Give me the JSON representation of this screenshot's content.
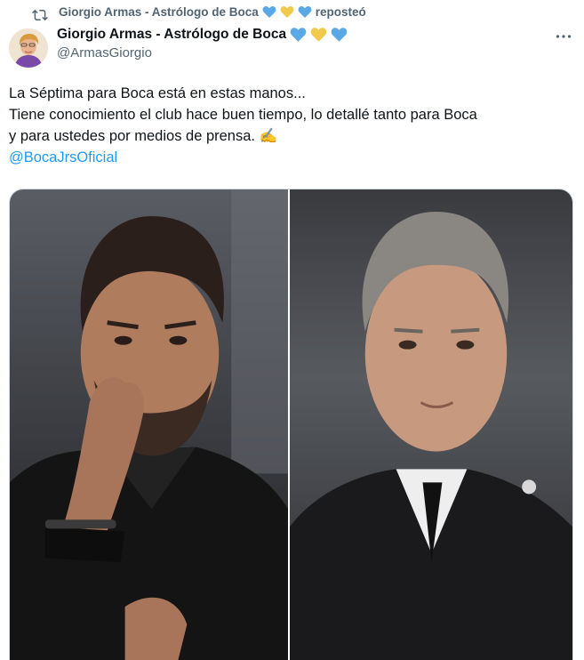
{
  "repost": {
    "text": "Giorgio Armas - Astrólogo de Boca",
    "suffix": "reposteó"
  },
  "author": {
    "name": "Giorgio Armas - Astrólogo de Boca",
    "handle": "@ArmasGiorgio"
  },
  "hearts": [
    "#5aa9e6",
    "#f2c94c",
    "#5aa9e6"
  ],
  "tweet": {
    "line1": "La Séptima para Boca está en estas manos...",
    "line2": "Tiene conocimiento el club hace buen tiempo, lo detallé tanto para Boca",
    "line3": "y para ustedes por medios de prensa. ✍️",
    "mention": "@BocaJrsOficial"
  },
  "icons": {
    "repost": "repost-icon",
    "more": "more-icon"
  }
}
